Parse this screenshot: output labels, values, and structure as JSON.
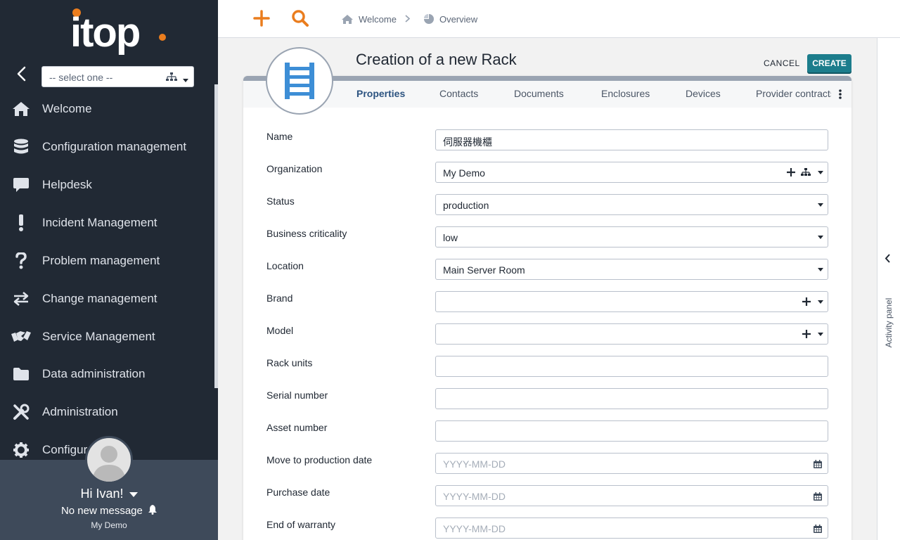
{
  "sidebar": {
    "org_select_value": "-- select one --",
    "menu": [
      {
        "label": "Welcome",
        "icon": "home-icon"
      },
      {
        "label": "Configuration management",
        "icon": "database-icon"
      },
      {
        "label": "Helpdesk",
        "icon": "chat-icon"
      },
      {
        "label": "Incident Management",
        "icon": "exclamation-icon"
      },
      {
        "label": "Problem management",
        "icon": "question-icon"
      },
      {
        "label": "Change management",
        "icon": "arrows-exchange-icon"
      },
      {
        "label": "Service Management",
        "icon": "handshake-icon"
      },
      {
        "label": "Data administration",
        "icon": "folder-icon"
      },
      {
        "label": "Administration",
        "icon": "tools-icon"
      },
      {
        "label": "Configur",
        "icon": "gear-icon"
      }
    ],
    "user": {
      "greeting": "Hi Ivan!",
      "messages": "No new message",
      "organization": "My Demo"
    }
  },
  "topbar": {
    "breadcrumb": [
      "Welcome",
      "Overview"
    ]
  },
  "header": {
    "title": "Creation of a new Rack",
    "cancel_label": "CANCEL",
    "create_label": "CREATE"
  },
  "tabs": [
    "Properties",
    "Contacts",
    "Documents",
    "Enclosures",
    "Devices",
    "Provider contracts"
  ],
  "fields": {
    "name": {
      "label": "Name",
      "value": "伺服器機櫃"
    },
    "organization": {
      "label": "Organization",
      "value": "My Demo"
    },
    "status": {
      "label": "Status",
      "value": "production"
    },
    "business_criticality": {
      "label": "Business criticality",
      "value": "low"
    },
    "location": {
      "label": "Location",
      "value": "Main Server Room"
    },
    "brand": {
      "label": "Brand",
      "value": ""
    },
    "model": {
      "label": "Model",
      "value": ""
    },
    "rack_units": {
      "label": "Rack units",
      "value": ""
    },
    "serial_number": {
      "label": "Serial number",
      "value": ""
    },
    "asset_number": {
      "label": "Asset number",
      "value": ""
    },
    "move_to_production_date": {
      "label": "Move to production date",
      "placeholder": "YYYY-MM-DD"
    },
    "purchase_date": {
      "label": "Purchase date",
      "placeholder": "YYYY-MM-DD"
    },
    "end_of_warranty": {
      "label": "End of warranty",
      "placeholder": "YYYY-MM-DD"
    }
  },
  "activity_panel": {
    "label": "Activity panel"
  },
  "colors": {
    "sidebar_bg": "#212934",
    "user_area_bg": "#3e4a5a",
    "accent_orange": "#ea7d1e",
    "primary_button": "#1c7d8c",
    "rack_icon_blue": "#3d8ed6",
    "active_tab": "#2c5380"
  }
}
